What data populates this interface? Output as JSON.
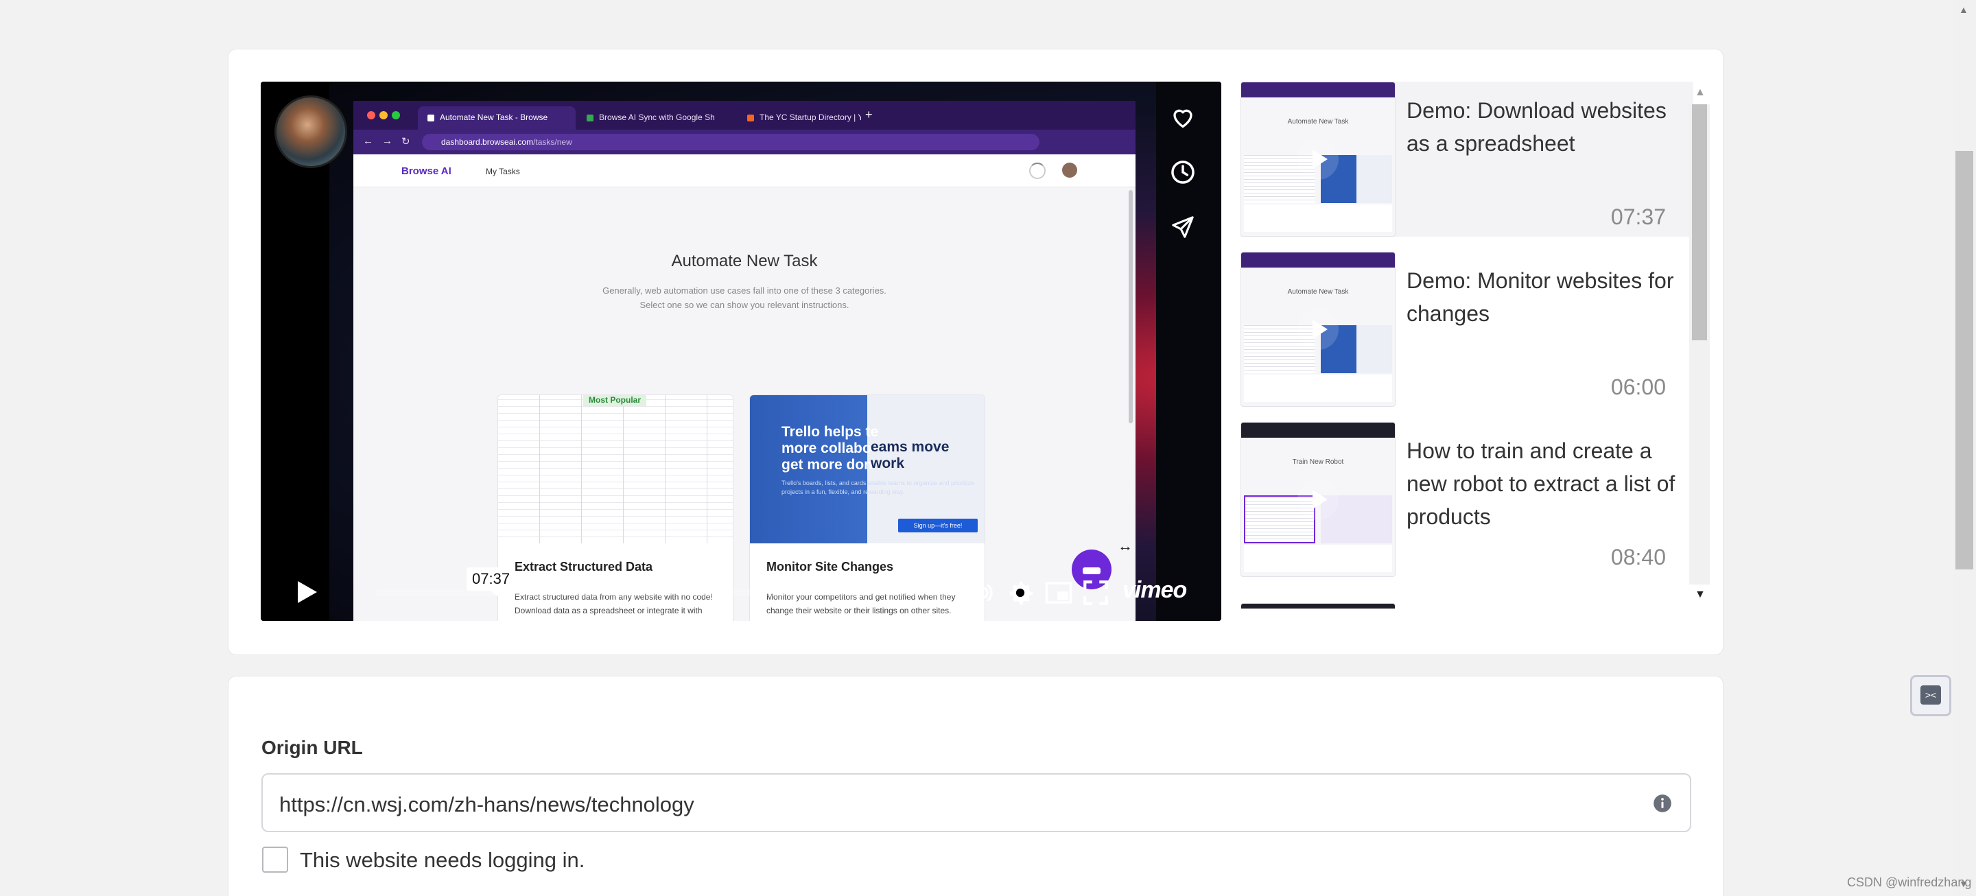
{
  "video": {
    "timestamp_tooltip": "07:37",
    "progress": 0.0,
    "brand": "vimeo",
    "side_actions": [
      "heart-icon",
      "clock-icon",
      "send-icon"
    ],
    "controls": [
      "play-icon",
      "volume-icon",
      "gear-icon",
      "pip-icon",
      "fullscreen-icon"
    ],
    "screen": {
      "tabs": [
        "Automate New Task - Browse",
        "Browse AI Sync with Google Sh",
        "The YC Startup Directory | Y C"
      ],
      "url_domain": "dashboard.browseai.com",
      "url_path": "/tasks/new",
      "nav_brand": "Browse AI",
      "nav_link": "My Tasks",
      "page_title": "Automate New Task",
      "subtitle_line1": "Generally, web automation use cases fall into one of these 3 categories.",
      "subtitle_line2": "Select one so we can show you relevant instructions.",
      "badge": "Most Popular",
      "card1_title": "Extract Structured Data",
      "card1_desc": "Extract structured data from any website with no code! Download data as a spreadsheet or integrate it with your software using Browse AI API.",
      "card2_title": "Monitor Site Changes",
      "card2_desc": "Monitor your competitors and get notified when they change their website or their listings on other sites.",
      "trello_headline1": "Trello helps te",
      "trello_headline2": "more collabo",
      "trello_headline3": "get more don",
      "trello_right": "eams move work",
      "trello_body": "Trello's boards, lists, and cards enable teams to organize and prioritize projects in a fun, flexible, and rewarding way.",
      "trello_button": "Sign up—it's free!"
    }
  },
  "playlist": [
    {
      "title": "Demo: Download websites as a spreadsheet",
      "duration": "07:37",
      "current": true,
      "thumb_title": "Automate New Task"
    },
    {
      "title": "Demo: Monitor websites for changes",
      "duration": "06:00",
      "current": false,
      "thumb_title": "Automate New Task"
    },
    {
      "title": "How to train and create a new robot to extract a list of products",
      "duration": "08:40",
      "current": false,
      "thumb_title": "Train New Robot"
    }
  ],
  "form": {
    "origin_label": "Origin URL",
    "origin_value": "https://cn.wsj.com/zh-hans/news/technology",
    "login_checkbox_label": "This website needs logging in.",
    "login_checked": false
  },
  "watermark": "CSDN @winfredzhang",
  "colors": {
    "brand_purple": "#5b2bbf",
    "video_chrome": "#2d1657",
    "page_bg": "#f2f2f3"
  }
}
